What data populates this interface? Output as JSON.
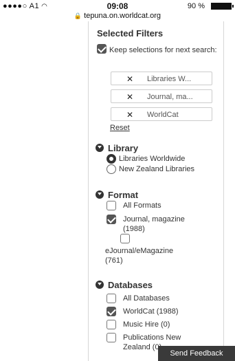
{
  "status_bar": {
    "carrier": "●●●●○ A1",
    "wifi_icon": "wifi-icon",
    "time": "09:08",
    "battery": "90 %"
  },
  "url_bar": {
    "url": "tepuna.on.worldcat.org"
  },
  "selected_filters": {
    "title": "Selected Filters",
    "keep_label": "Keep selections for next search:",
    "keep_checked": true,
    "chips": [
      {
        "label": "Libraries W..."
      },
      {
        "label": "Journal, ma..."
      },
      {
        "label": "WorldCat"
      }
    ],
    "remove_symbol": "✕",
    "reset_label": "Reset"
  },
  "library": {
    "title": "Library",
    "options": [
      {
        "label": "Libraries Worldwide",
        "selected": true
      },
      {
        "label": "New Zealand Libraries",
        "selected": false
      }
    ]
  },
  "format": {
    "title": "Format",
    "options": [
      {
        "label": "All Formats",
        "checked": false
      },
      {
        "label": "Journal, magazine",
        "count": "(1988)",
        "checked": true
      },
      {
        "label": "eJournal/eMagazine",
        "count": "(761)",
        "checked": false
      }
    ]
  },
  "databases": {
    "title": "Databases",
    "options": [
      {
        "label": "All Databases",
        "checked": false
      },
      {
        "label": "WorldCat (1988)",
        "checked": true
      },
      {
        "label": "Music Hire (0)",
        "checked": false
      },
      {
        "label": "Publications New",
        "label2": "Zealand (0)",
        "checked": false
      }
    ]
  },
  "feedback": {
    "label": "Send Feedback"
  }
}
